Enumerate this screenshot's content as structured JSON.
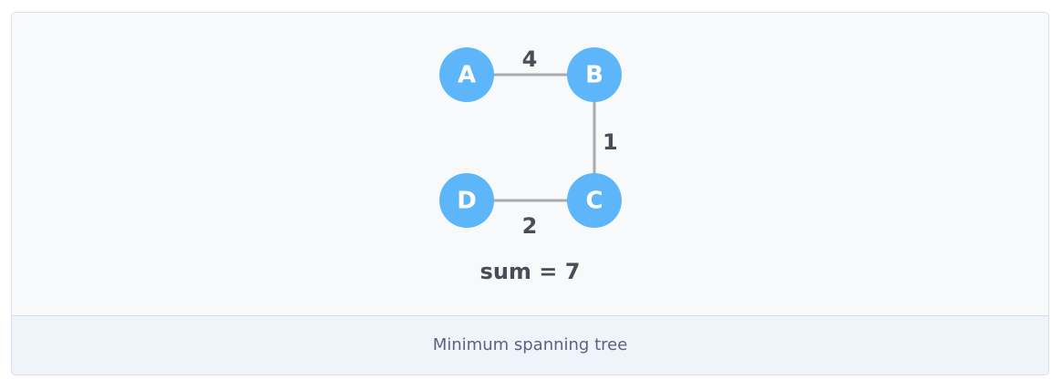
{
  "colors": {
    "node_fill": "#5cb6f9",
    "edge_stroke": "#a9abb0",
    "text_dark": "#4a4d55",
    "caption_text": "#5e6180"
  },
  "graph": {
    "nodes": [
      {
        "id": "A",
        "label": "A"
      },
      {
        "id": "B",
        "label": "B"
      },
      {
        "id": "C",
        "label": "C"
      },
      {
        "id": "D",
        "label": "D"
      }
    ],
    "edges": [
      {
        "from": "A",
        "to": "B",
        "weight": "4"
      },
      {
        "from": "B",
        "to": "C",
        "weight": "1"
      },
      {
        "from": "D",
        "to": "C",
        "weight": "2"
      }
    ]
  },
  "sum_label": "sum = 7",
  "caption": "Minimum spanning tree"
}
